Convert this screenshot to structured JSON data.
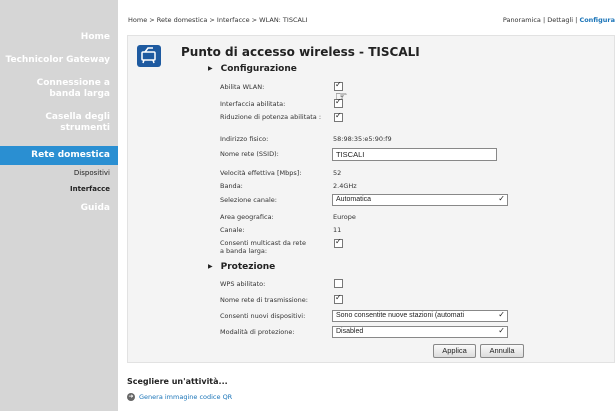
{
  "sidebar": {
    "items": [
      {
        "label": "Home"
      },
      {
        "label": "Technicolor Gateway"
      },
      {
        "label": "Connessione a banda larga"
      },
      {
        "label": "Casella degli strumenti"
      },
      {
        "label": "Rete domestica"
      },
      {
        "label": "Dispositivi"
      },
      {
        "label": "Interfacce"
      },
      {
        "label": "Guida"
      }
    ]
  },
  "breadcrumb": "Home > Rete domestica > Interfacce > WLAN: TISCALI",
  "toplinks": {
    "overview": "Panoramica",
    "sep1": "|",
    "details": "Dettagli",
    "sep2": "|",
    "configure": "Configura"
  },
  "page_title": "Punto di accesso wireless - TISCALI",
  "config": {
    "title": "Configurazione",
    "enable_wlan": {
      "label": "Abilita WLAN:",
      "checked": true
    },
    "interface_enabled": {
      "label": "Interfaccia abilitata:",
      "checked": true
    },
    "power_reduction": {
      "label": "Riduzione di potenza abilitata :",
      "checked": true
    },
    "mac": {
      "label": "Indirizzo fisico:",
      "value": "58:98:35:e5:90:f9"
    },
    "ssid": {
      "label": "Nome rete (SSID):",
      "value": "TISCALI"
    },
    "speed": {
      "label": "Velocità effettiva [Mbps]:",
      "value": "52"
    },
    "band": {
      "label": "Banda:",
      "value": "2.4GHz"
    },
    "channel_select": {
      "label": "Selezione canale:",
      "value": "Automatica"
    },
    "region": {
      "label": "Area geografica:",
      "value": "Europe"
    },
    "channel": {
      "label": "Canale:",
      "value": "11"
    },
    "multicast": {
      "label": "Consenti multicast da rete a banda larga:",
      "checked": true
    }
  },
  "security": {
    "title": "Protezione",
    "wps": {
      "label": "WPS abilitato:",
      "checked": false
    },
    "broadcast": {
      "label": "Nome rete di trasmissione:",
      "checked": true
    },
    "new_devices": {
      "label": "Consenti nuovi dispositivi:",
      "value": "Sono consentite nuove stazioni (automati"
    },
    "protection_mode": {
      "label": "Modalità di protezione:",
      "value": "Disabled"
    }
  },
  "buttons": {
    "apply": "Applica",
    "cancel": "Annulla"
  },
  "activity": {
    "title": "Scegliere un'attività...",
    "link": "Genera immagine codice QR"
  },
  "colors": {
    "sidebar_bg": "#d6d6d6",
    "active_bg": "#2a8fd2",
    "link": "#1a74b8"
  }
}
